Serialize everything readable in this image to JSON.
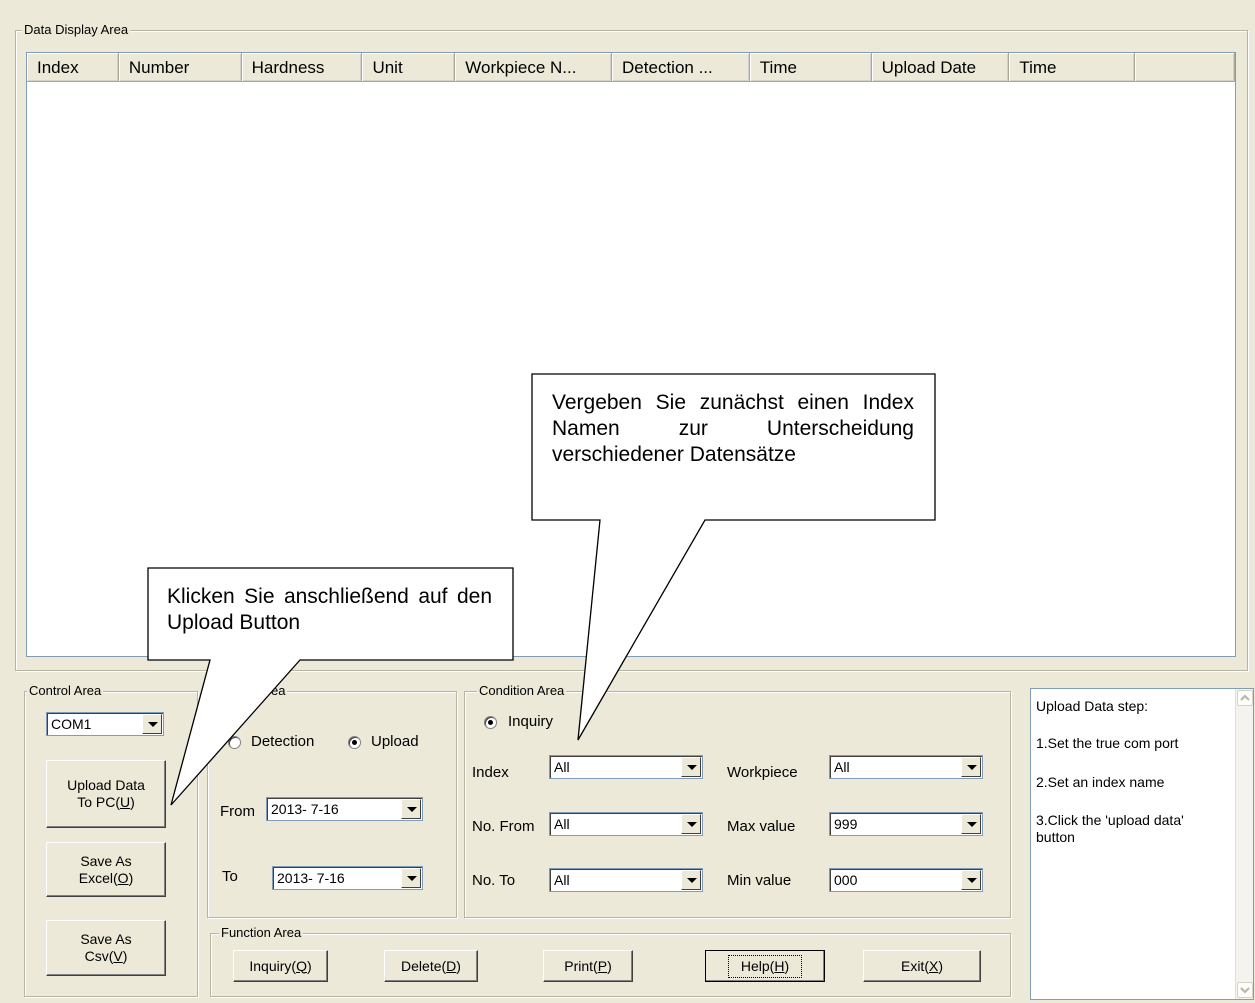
{
  "data_display": {
    "label": "Data Display Area",
    "columns": [
      "Index",
      "Number",
      "Hardness",
      "Unit",
      "Workpiece N...",
      "Detection ...",
      "Time",
      "Upload Date",
      "Time",
      ""
    ]
  },
  "control_area": {
    "label": "Control Area",
    "port_value": "COM1",
    "upload_btn": {
      "line1": "Upload Data",
      "line2_pre": "To PC(",
      "line2_key": "U",
      "line2_post": ")"
    },
    "excel_btn": {
      "line1": "Save As",
      "line2_pre": "Excel(",
      "line2_key": "O",
      "line2_post": ")"
    },
    "csv_btn": {
      "line1": "Save As",
      "line2_pre": "Csv(",
      "line2_key": "V",
      "line2_post": ")"
    }
  },
  "date_area": {
    "label": "Area",
    "radio_detection": "Detection",
    "radio_upload": "Upload",
    "from_label": "From",
    "from_value": "2013- 7-16",
    "to_label": "To",
    "to_value": "2013- 7-16"
  },
  "condition_area": {
    "label": "Condition Area",
    "radio_inquiry": "Inquiry",
    "index_label": "Index",
    "index_value": "All",
    "nofrom_label": "No. From",
    "nofrom_value": "All",
    "noto_label": "No. To",
    "noto_value": "All",
    "workpiece_label": "Workpiece",
    "workpiece_value": "All",
    "max_label": "Max value",
    "max_value": "999",
    "min_label": "Min value",
    "min_value": "000"
  },
  "function_area": {
    "label": "Function Area",
    "inquiry": {
      "pre": "Inquiry(",
      "key": "Q",
      "post": ")"
    },
    "delete": {
      "pre": "Delete(",
      "key": "D",
      "post": ")"
    },
    "print": {
      "pre": "Print(",
      "key": "P",
      "post": ")"
    },
    "help": {
      "pre": "Help(",
      "key": "H",
      "post": ")"
    },
    "exit": {
      "pre": "Exit(",
      "key": "X",
      "post": ")"
    }
  },
  "help_panel": {
    "title": "Upload Data step:",
    "step1": "1.Set the true com port",
    "step2": "2.Set an index name",
    "step3a": "3.Click the 'upload data'",
    "step3b": "button"
  },
  "callouts": {
    "index_note": "Vergeben Sie zunächst einen Index Namen zur Unterscheidung verschiedener Datensätze",
    "upload_note": "Klicken Sie anschließend auf den Upload Button"
  }
}
